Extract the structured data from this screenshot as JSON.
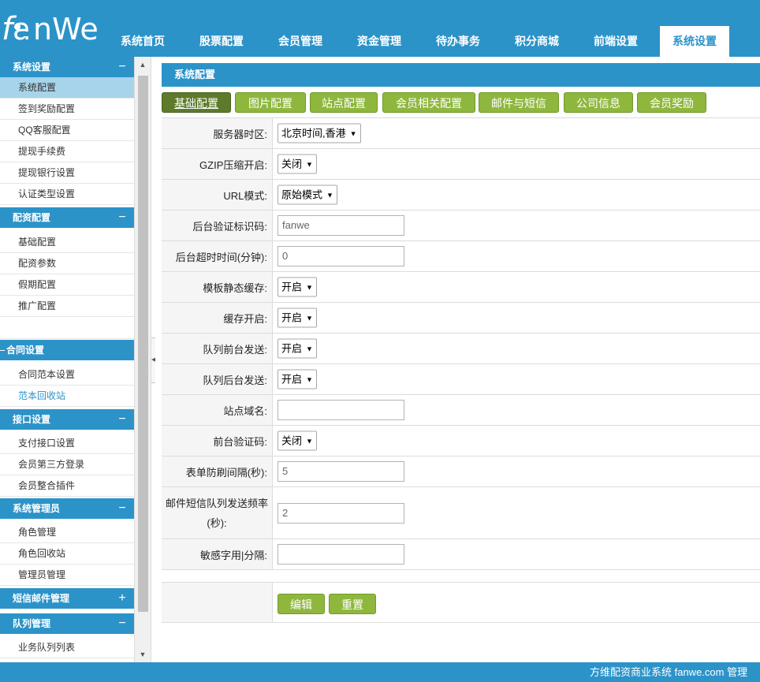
{
  "header": {
    "logo_text": "fanWe",
    "nav": [
      {
        "label": "系统首页"
      },
      {
        "label": "股票配置"
      },
      {
        "label": "会员管理"
      },
      {
        "label": "资金管理"
      },
      {
        "label": "待办事务"
      },
      {
        "label": "积分商城"
      },
      {
        "label": "前端设置"
      },
      {
        "label": "系统设置",
        "active": true
      }
    ]
  },
  "sidebar": {
    "groups": [
      {
        "title": "系统设置",
        "toggle": "−",
        "items": [
          "系统配置",
          "签到奖励配置",
          "QQ客服配置",
          "提现手续费",
          "提现银行设置",
          "认证类型设置"
        ]
      },
      {
        "title": "配资配置",
        "toggle": "−",
        "items": [
          "基础配置",
          "配资参数",
          "假期配置",
          "推广配置"
        ]
      },
      {
        "title": "合同设置",
        "toggle": "",
        "items": [
          "合同范本设置",
          "范本回收站"
        ]
      },
      {
        "title": "接口设置",
        "toggle": "−",
        "items": [
          "支付接口设置",
          "会员第三方登录",
          "会员整合插件"
        ]
      },
      {
        "title": "系统管理员",
        "toggle": "−",
        "items": [
          "角色管理",
          "角色回收站",
          "管理员管理"
        ]
      },
      {
        "title": "短信邮件管理",
        "toggle": "+",
        "items": []
      },
      {
        "title": "队列管理",
        "toggle": "−",
        "items": [
          "业务队列列表"
        ]
      }
    ],
    "selected_item": "系统配置"
  },
  "main": {
    "page_title": "系统配置",
    "tabs": [
      "基础配置",
      "图片配置",
      "站点配置",
      "会员相关配置",
      "邮件与短信",
      "公司信息",
      "会员奖励"
    ],
    "active_tab": "基础配置",
    "fields": [
      {
        "label": "服务器时区:",
        "type": "select",
        "value": "北京时间,香港"
      },
      {
        "label": "GZIP压缩开启:",
        "type": "select",
        "value": "关闭"
      },
      {
        "label": "URL模式:",
        "type": "select",
        "value": "原始模式"
      },
      {
        "label": "后台验证标识码:",
        "type": "input",
        "value": "fanwe"
      },
      {
        "label": "后台超时时间(分钟):",
        "type": "input",
        "value": "0"
      },
      {
        "label": "模板静态缓存:",
        "type": "select",
        "value": "开启"
      },
      {
        "label": "缓存开启:",
        "type": "select",
        "value": "开启"
      },
      {
        "label": "队列前台发送:",
        "type": "select",
        "value": "开启"
      },
      {
        "label": "队列后台发送:",
        "type": "select",
        "value": "开启"
      },
      {
        "label": "站点域名:",
        "type": "input",
        "value": ""
      },
      {
        "label": "前台验证码:",
        "type": "select",
        "value": "关闭"
      },
      {
        "label": "表单防刷间隔(秒):",
        "type": "input",
        "value": "5"
      },
      {
        "label": "邮件短信队列发送频率(秒):",
        "type": "input",
        "value": "2"
      },
      {
        "label": "敏感字用|分隔:",
        "type": "input",
        "value": ""
      }
    ],
    "buttons": {
      "edit": "编辑",
      "reset": "重置"
    }
  },
  "footer": {
    "text": "方维配资商业系统 fanwe.com 管理"
  },
  "colors": {
    "brand": "#2c93c9",
    "button_green": "#8fb73d",
    "tab_active": "#5d7b2a",
    "selected_item": "#a7d4ea"
  }
}
